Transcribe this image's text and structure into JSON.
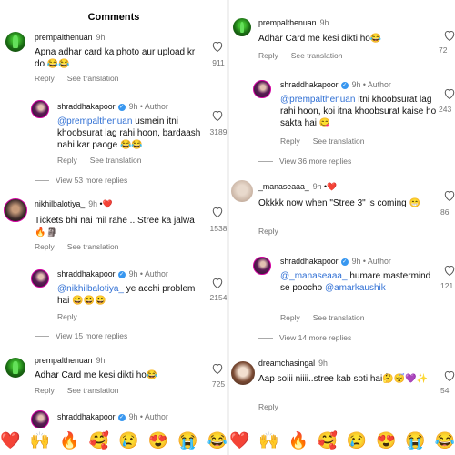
{
  "left": {
    "header_title": "Comments",
    "comments": [
      {
        "user": "prempalthenuan",
        "time": "9h",
        "text": "Apna adhar card ka photo aur upload kr do 😂😂",
        "reply": "Reply",
        "see_translation": "See translation",
        "likes": "911"
      },
      {
        "user": "shraddhakapoor",
        "time": "9h",
        "author": "Author",
        "mention": "@prempalthenuan",
        "text": " usmein itni khoobsurat lag rahi hoon, bardaash nahi kar paoge 😂😂",
        "reply": "Reply",
        "see_translation": "See translation",
        "likes": "3189"
      },
      {
        "view_more": "View 53 more replies"
      },
      {
        "user": "nikhilbalotiya_",
        "time": "9h",
        "emoji": "•❤️",
        "text": "Tickets bhi nai mil rahe .. Stree ka jalwa 🔥🗿",
        "reply": "Reply",
        "see_translation": "See translation",
        "likes": "1538"
      },
      {
        "user": "shraddhakapoor",
        "time": "9h",
        "author": "Author",
        "mention": "@nikhilbalotiya_",
        "text": " ye acchi problem hai 😀😀😀",
        "reply": "Reply",
        "likes": "2154"
      },
      {
        "view_more": "View 15 more replies"
      },
      {
        "user": "prempalthenuan",
        "time": "9h",
        "text": "Adhar Card me kesi dikti ho😂",
        "reply": "Reply",
        "see_translation": "See translation",
        "likes": "725"
      },
      {
        "user": "shraddhakapoor",
        "time": "9h",
        "author": "Author"
      }
    ],
    "emojis": [
      "❤️",
      "🙌",
      "🔥",
      "🥰",
      "😢",
      "😍",
      "😭",
      "😂"
    ]
  },
  "right": {
    "comments": [
      {
        "user": "prempalthenuan",
        "time": "9h",
        "text": "Adhar Card me kesi dikti ho😂",
        "reply": "Reply",
        "see_translation": "See translation",
        "likes": "72"
      },
      {
        "user": "shraddhakapoor",
        "time": "9h",
        "author": "Author",
        "mention": "@prempalthenuan",
        "text": " itni khoobsurat lag rahi hoon, koi itna khoobsurat kaise ho sakta hai 😋",
        "reply": "Reply",
        "see_translation": "See translation",
        "likes": "243"
      },
      {
        "view_more": "View 36 more replies"
      },
      {
        "user": "_manaseaaa_",
        "time": "9h",
        "emoji": "•❤️",
        "text": "Okkkk now when \"Stree 3\" is coming 😁",
        "reply": "Reply",
        "likes": "86"
      },
      {
        "user": "shraddhakapoor",
        "time": "9h",
        "author": "Author",
        "mention": "@_manaseaaa_",
        "text": " humare mastermind se poocho ",
        "mention2": "@amarkaushik",
        "reply": "Reply",
        "see_translation": "See translation",
        "likes": "121"
      },
      {
        "view_more": "View 14 more replies"
      },
      {
        "user": "dreamchasingal",
        "time": "9h",
        "text": "Aap soiii niiii..stree kab soti hai🤔😴💜✨",
        "reply": "Reply",
        "likes": "54"
      }
    ],
    "emojis": [
      "❤️",
      "🙌",
      "🔥",
      "🥰",
      "😢",
      "😍",
      "😭",
      "😂"
    ]
  },
  "colors": {
    "mention": "#2f6fd4",
    "muted": "#737373",
    "verified": "#3897f0"
  },
  "icons": {
    "like": "heart-outline-icon",
    "verified": "verified-badge-icon"
  }
}
